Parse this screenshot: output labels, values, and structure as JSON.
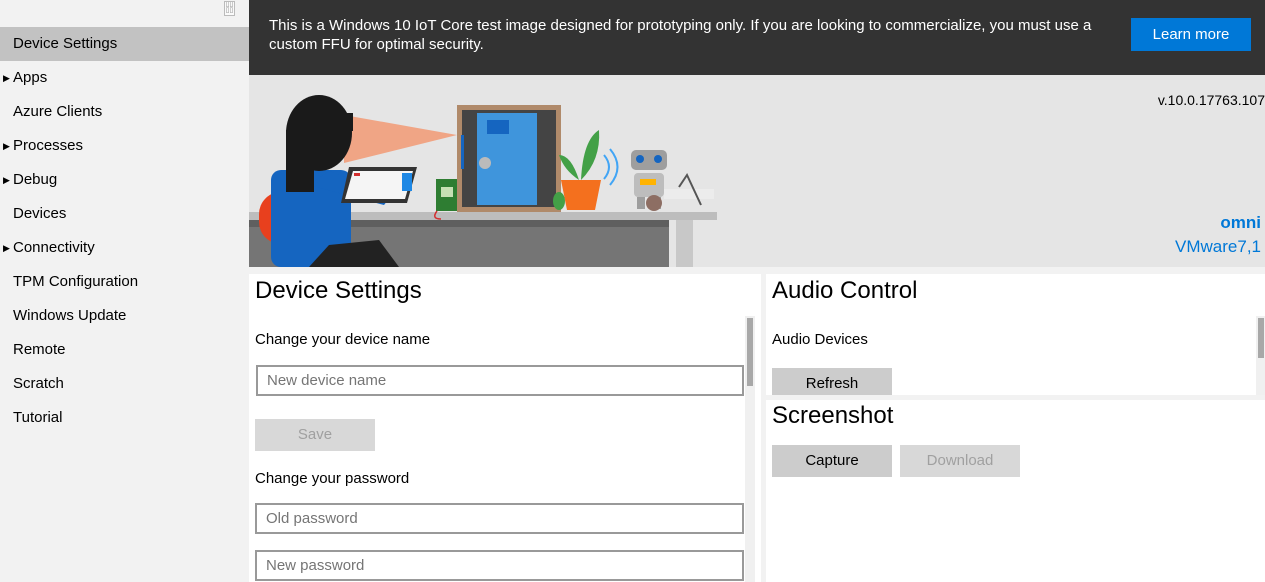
{
  "sidebar": {
    "collapse_icon": "collapse-icon",
    "items": [
      {
        "label": "Device Settings",
        "expandable": false,
        "selected": true
      },
      {
        "label": "Apps",
        "expandable": true,
        "selected": false
      },
      {
        "label": "Azure Clients",
        "expandable": false,
        "selected": false
      },
      {
        "label": "Processes",
        "expandable": true,
        "selected": false
      },
      {
        "label": "Debug",
        "expandable": true,
        "selected": false
      },
      {
        "label": "Devices",
        "expandable": false,
        "selected": false
      },
      {
        "label": "Connectivity",
        "expandable": true,
        "selected": false
      },
      {
        "label": "TPM Configuration",
        "expandable": false,
        "selected": false
      },
      {
        "label": "Windows Update",
        "expandable": false,
        "selected": false
      },
      {
        "label": "Remote",
        "expandable": false,
        "selected": false
      },
      {
        "label": "Scratch",
        "expandable": false,
        "selected": false
      },
      {
        "label": "Tutorial",
        "expandable": false,
        "selected": false
      }
    ],
    "arrow_glyph": "▶"
  },
  "banner": {
    "message": "This is a Windows 10 IoT Core test image designed for prototyping only. If you are looking to commercialize, you must use a custom FFU for optimal security.",
    "learn_more_label": "Learn more"
  },
  "hero": {
    "version": "v.10.0.17763.107",
    "device_name": "omni",
    "device_model": "VMware7,1"
  },
  "device_settings": {
    "title": "Device Settings",
    "change_name_label": "Change your device name",
    "device_name_placeholder": "New device name",
    "save_label": "Save",
    "change_password_label": "Change your password",
    "old_password_placeholder": "Old password",
    "new_password_placeholder": "New password"
  },
  "audio_control": {
    "title": "Audio Control",
    "devices_label": "Audio Devices",
    "refresh_label": "Refresh"
  },
  "screenshot": {
    "title": "Screenshot",
    "capture_label": "Capture",
    "download_label": "Download"
  },
  "colors": {
    "accent": "#0078d7",
    "banner_bg": "#333333",
    "selected_nav": "#c2c2c2"
  }
}
